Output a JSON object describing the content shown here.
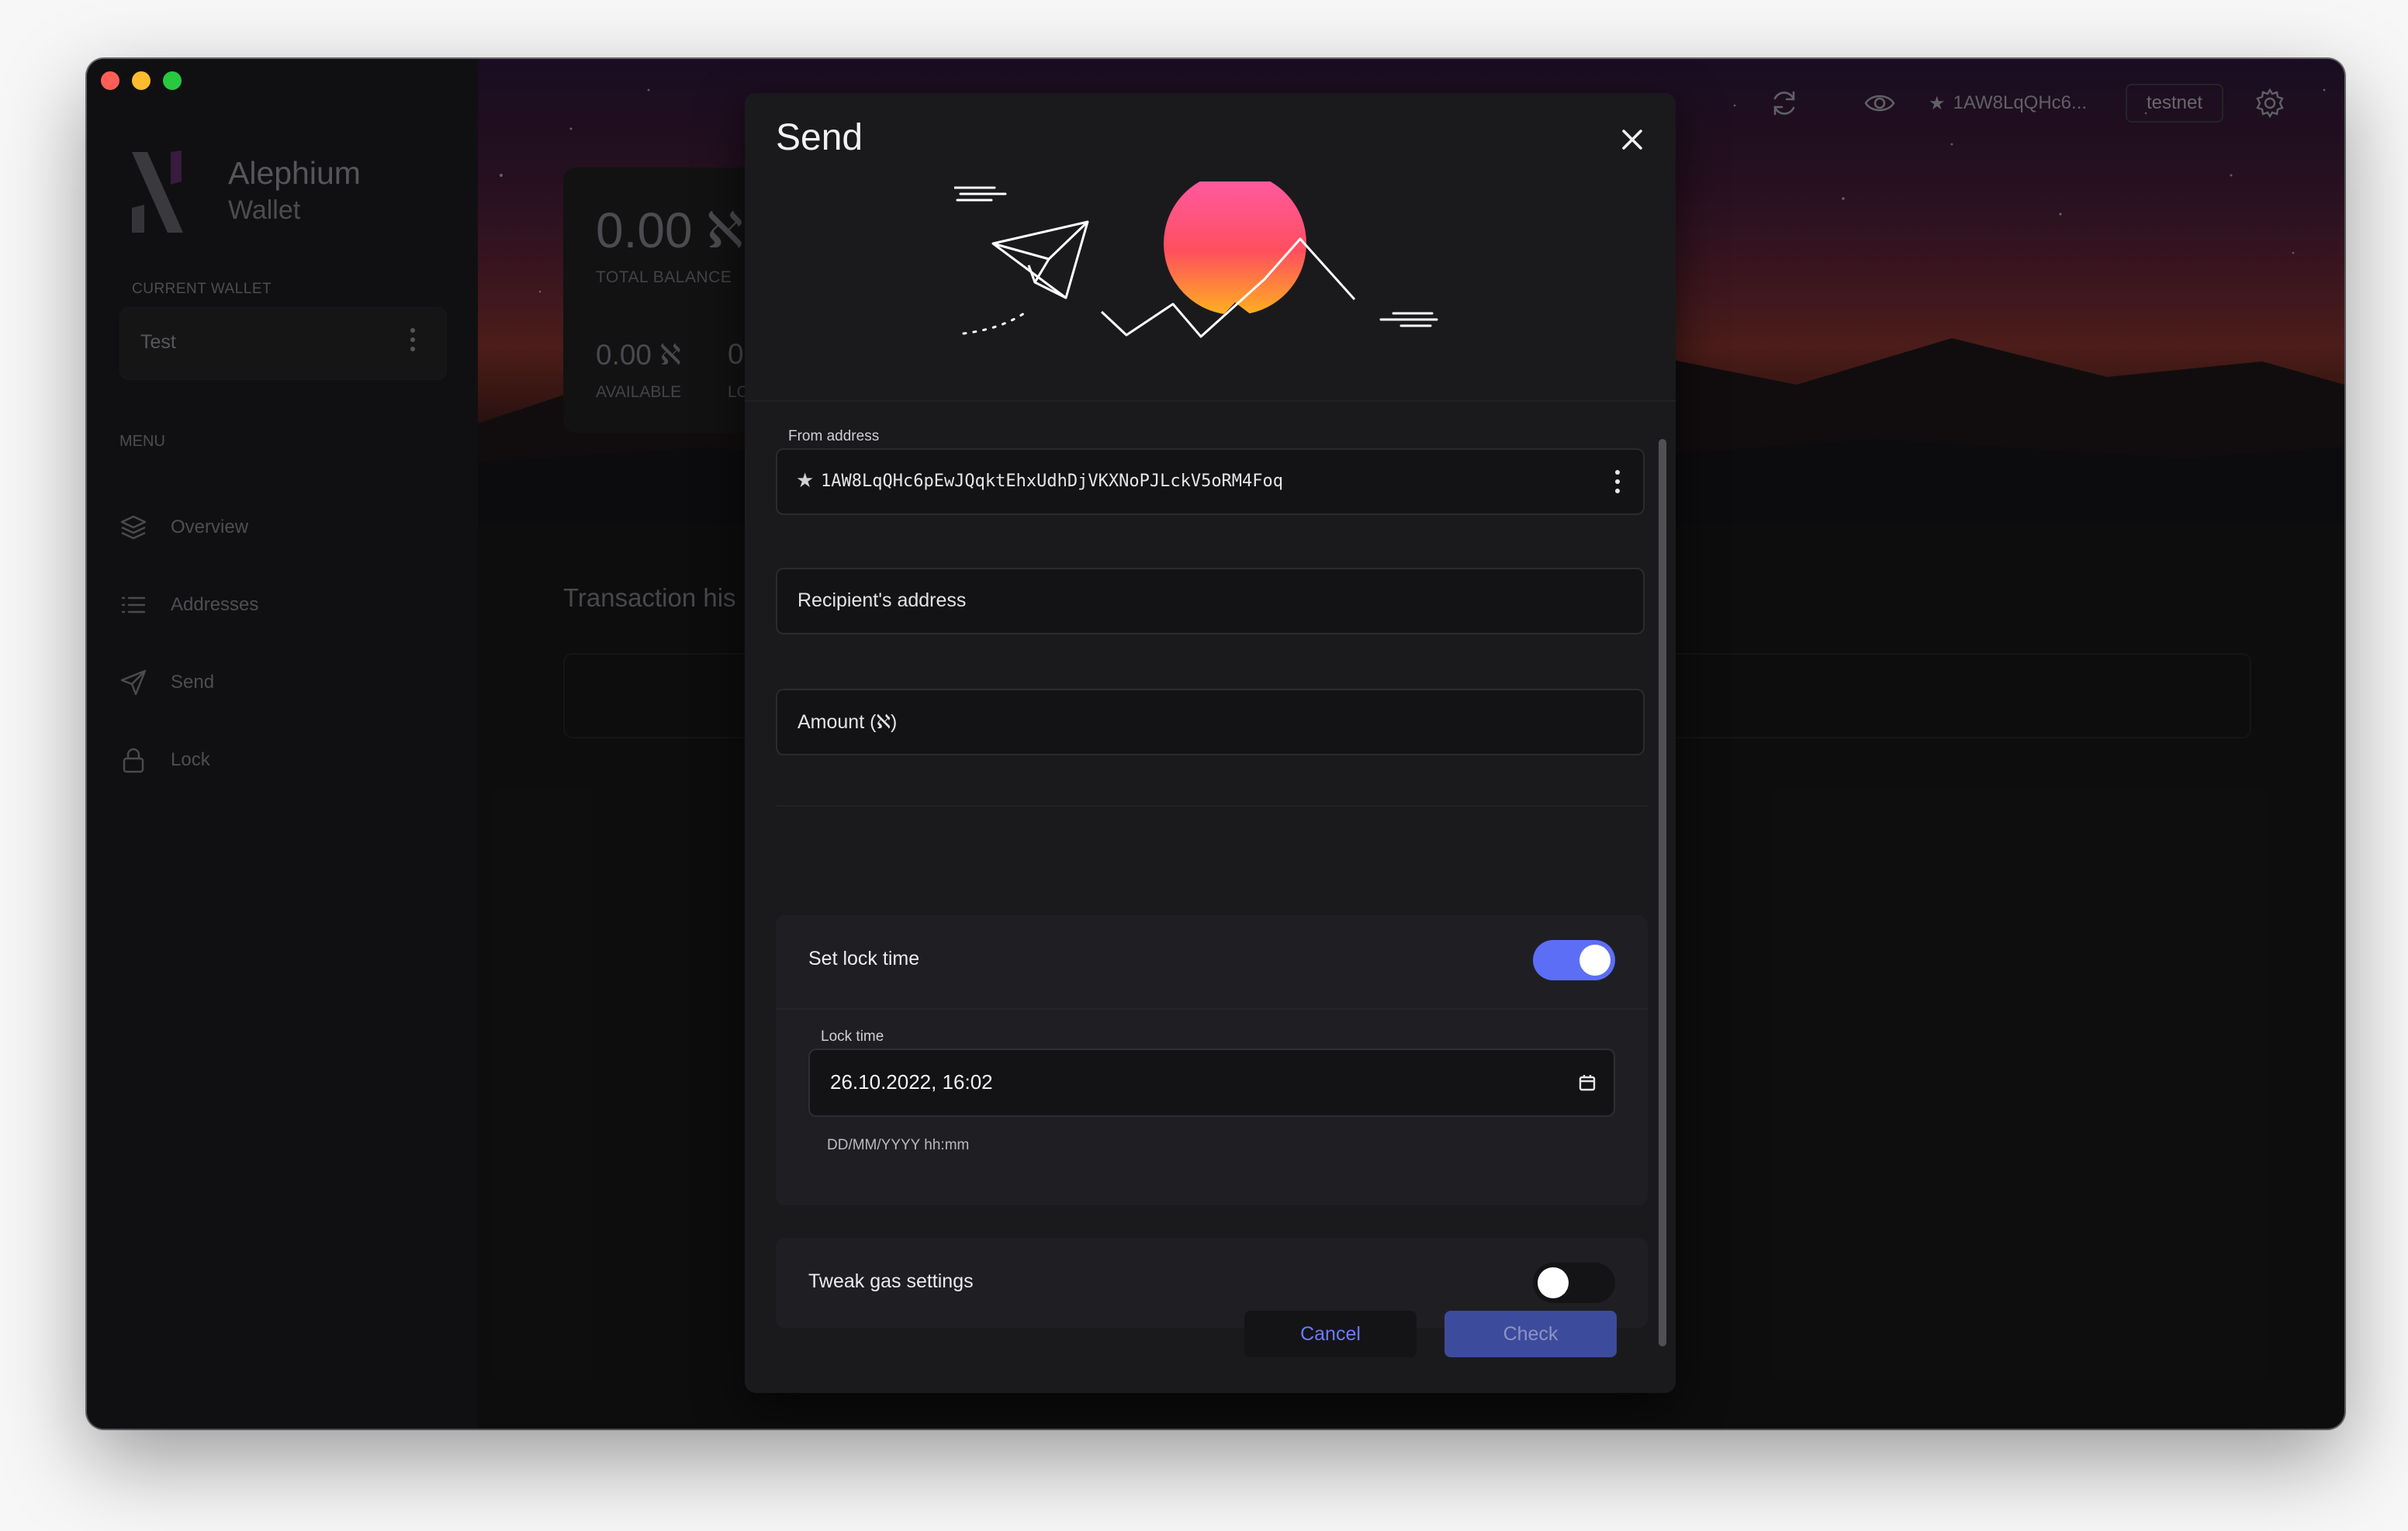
{
  "app": {
    "brand_name": "Alephium",
    "brand_sub": "Wallet",
    "current_wallet_label": "CURRENT WALLET",
    "current_wallet": "Test",
    "menu_label": "MENU",
    "nav": [
      {
        "label": "Overview",
        "icon": "layers-icon"
      },
      {
        "label": "Addresses",
        "icon": "list-icon"
      },
      {
        "label": "Send",
        "icon": "send-icon"
      },
      {
        "label": "Lock",
        "icon": "lock-icon"
      }
    ]
  },
  "topbar": {
    "address_short": "1AW8LqQHc6...",
    "network": "testnet"
  },
  "overview": {
    "total_balance": "0.00 ℵ",
    "total_balance_label": "TOTAL BALANCE",
    "available": "0.00 ℵ",
    "available_label": "AVAILABLE",
    "locked": "0",
    "locked_label": "LO",
    "transaction_history_title": "Transaction his"
  },
  "modal": {
    "title": "Send",
    "from_label": "From address",
    "from_address": "1AW8LqQHc6pEwJQqktEhxUdhDjVKXNoPJLckV5oRM4Foq",
    "recipient_placeholder": "Recipient's address",
    "amount_placeholder": "Amount (ℵ)",
    "lock_time_toggle_label": "Set lock time",
    "lock_time_enabled": true,
    "lock_time_label": "Lock time",
    "lock_time_value": "26.10.2022, 16:02",
    "lock_time_hint": "DD/MM/YYYY hh:mm",
    "gas_toggle_label": "Tweak gas settings",
    "gas_enabled": false,
    "cancel_label": "Cancel",
    "check_label": "Check"
  },
  "colors": {
    "accent": "#5b6ef5",
    "check_button": "#3d4b9c",
    "cancel_text": "#6c7cf5"
  }
}
